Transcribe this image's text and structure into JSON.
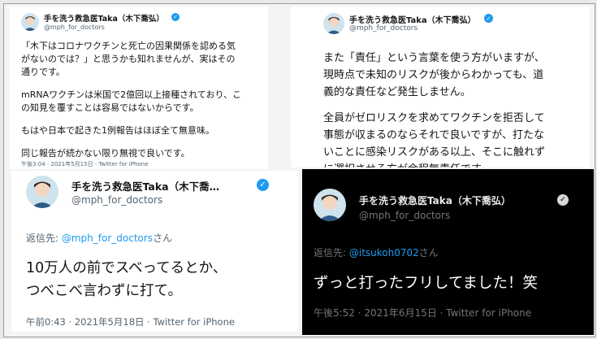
{
  "tweet1": {
    "name": "手を洗う救急医Taka（木下喬弘）",
    "handle": "@mph_for_doctors",
    "lines": [
      "「木下はコロナワクチンと死亡の因果関係を認める気",
      "がないのでは？」と思うかも知れませんが、実はその",
      "通りです。",
      "mRNAワクチンは米国で2億回以上接種されており、こ",
      "の知見を覆すことは容易ではないからです。",
      "もはや日本で起きた1例報告はほぼ全て無意味。",
      "同じ報告が続かない限り無視で良いです。"
    ],
    "meta": "午後3:04 · 2021年5月15日 · Twitter for iPhone"
  },
  "tweet2": {
    "name": "手を洗う救急医Taka（木下喬弘）",
    "handle": "@mph_for_doctors",
    "lines": [
      "また「責任」という言葉を使う方がいますが、",
      "現時点で未知のリスクが後からわかっても、道",
      "義的な責任など発生しません。",
      "全員がゼロリスクを求めてワクチンを拒否して",
      "事態が収まるのならそれで良いですが、打たな",
      "いことに感染リスクがある以上、そこに触れず",
      "に選択させる方が余程無責任です。"
    ]
  },
  "tweet3": {
    "name": "手を洗う救急医Taka（木下喬…",
    "handle": "@mph_for_doctors",
    "reply_prefix": "返信先: ",
    "reply_handle": "@mph_for_doctors",
    "reply_suffix": "さん",
    "lines": [
      "10万人の前でスベってるとか、",
      "つべこべ言わずに打て。"
    ],
    "meta": "午前0:43 · 2021年5月18日 · Twitter for iPhone"
  },
  "tweet4": {
    "name": "手を洗う救急医Taka（木下喬弘）",
    "handle": "@mph_for_doctors",
    "reply_prefix": "返信先: ",
    "reply_handle": "@itsukoh0702",
    "reply_suffix": "さん",
    "lines": [
      "ずっと打ったフリしてました！笑"
    ],
    "meta": "午後5:52 · 2021年6月15日 · Twitter for iPhone"
  },
  "verified_glyph": "✓",
  "icons": [
    "avatar-icon",
    "verified-badge-icon"
  ],
  "colors": {
    "link": "#1d9bf0",
    "verified_light": "#1d9bf0",
    "dark_bg": "#000000"
  }
}
